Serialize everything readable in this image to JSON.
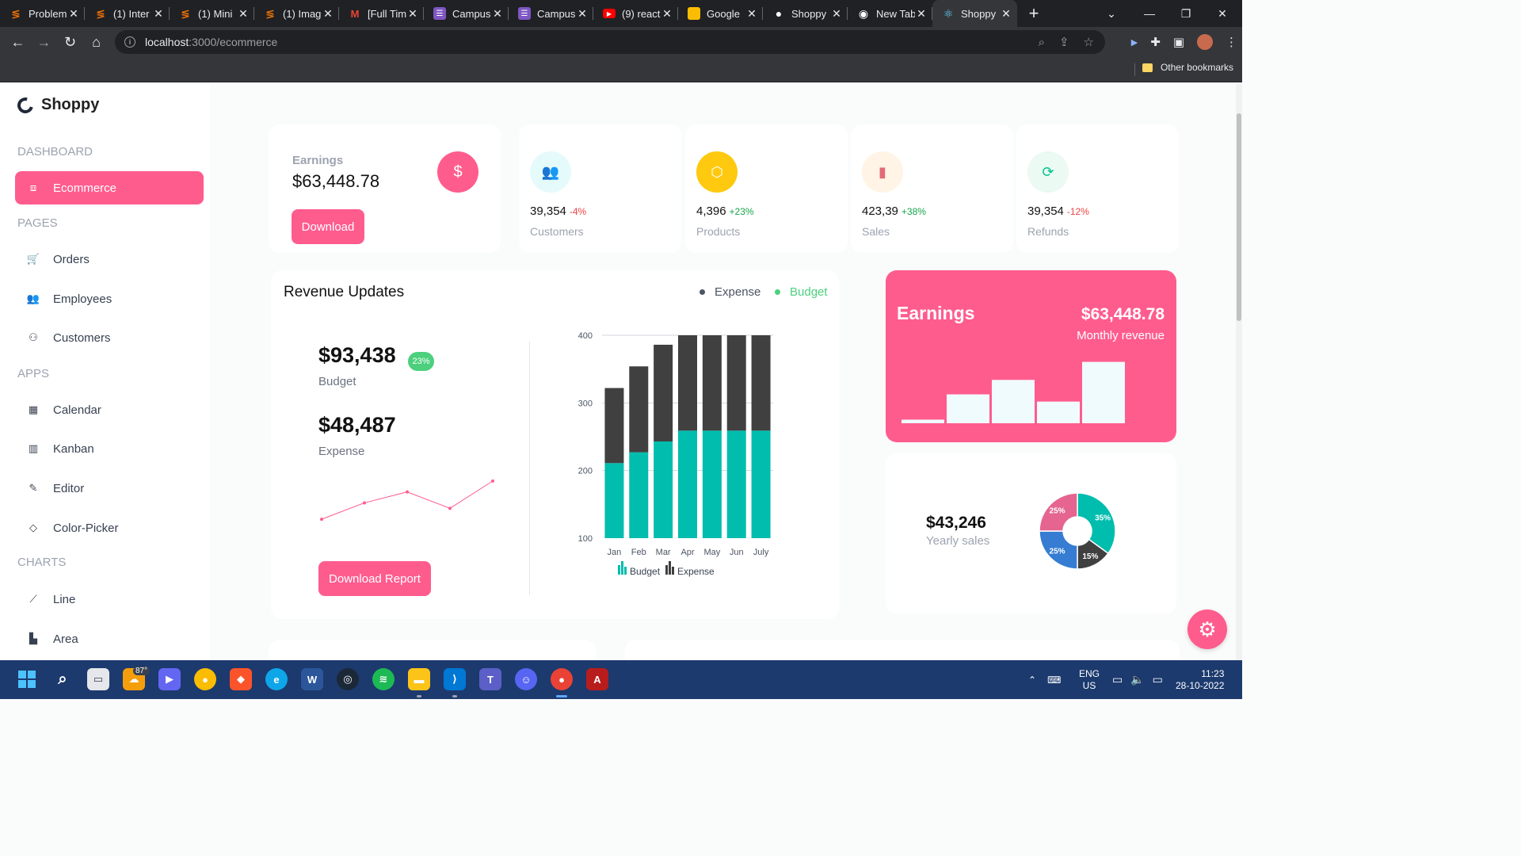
{
  "browser": {
    "tabs": [
      {
        "title": "Problem",
        "favicon": "codeforces",
        "color": "#e8710a"
      },
      {
        "title": "(1) Inter",
        "favicon": "codeforces",
        "color": "#e8710a"
      },
      {
        "title": "(1) Mini",
        "favicon": "codeforces",
        "color": "#e8710a"
      },
      {
        "title": "(1) Imag",
        "favicon": "codeforces",
        "color": "#e8710a"
      },
      {
        "title": "[Full Tim",
        "favicon": "gmail",
        "color": "#ea4335"
      },
      {
        "title": "Campus",
        "favicon": "list",
        "color": "#7e57c2"
      },
      {
        "title": "Campus",
        "favicon": "list",
        "color": "#7e57c2"
      },
      {
        "title": "(9) react",
        "favicon": "youtube",
        "color": "#ff0000"
      },
      {
        "title": "Google",
        "favicon": "keep",
        "color": "#fbbc04"
      },
      {
        "title": "Shoppy",
        "favicon": "github",
        "color": "#ffffff"
      },
      {
        "title": "New Tab",
        "favicon": "chrome",
        "color": "#ffffff"
      },
      {
        "title": "Shoppy",
        "favicon": "react",
        "color": "#61dafb",
        "active": true
      }
    ],
    "url_host": "localhost",
    "url_path": ":3000/ecommerce",
    "bookmarks_other": "Other bookmarks"
  },
  "sidebar": {
    "brand": "Shoppy",
    "sections": [
      {
        "title": "DASHBOARD",
        "items": [
          {
            "label": "Ecommerce",
            "icon": "shopping-bag-icon",
            "active": true
          }
        ]
      },
      {
        "title": "PAGES",
        "items": [
          {
            "label": "Orders",
            "icon": "cart-icon"
          },
          {
            "label": "Employees",
            "icon": "people-icon"
          },
          {
            "label": "Customers",
            "icon": "customer-icon"
          }
        ]
      },
      {
        "title": "APPS",
        "items": [
          {
            "label": "Calendar",
            "icon": "calendar-icon"
          },
          {
            "label": "Kanban",
            "icon": "kanban-icon"
          },
          {
            "label": "Editor",
            "icon": "edit-icon"
          },
          {
            "label": "Color-Picker",
            "icon": "color-picker-icon"
          }
        ]
      },
      {
        "title": "CHARTS",
        "items": [
          {
            "label": "Line",
            "icon": "line-chart-icon"
          },
          {
            "label": "Area",
            "icon": "area-chart-icon"
          }
        ]
      }
    ]
  },
  "earnings_card": {
    "label": "Earnings",
    "value": "$63,448.78",
    "button": "Download",
    "icon": "dollar-icon"
  },
  "stats": [
    {
      "value": "39,354",
      "percentage": "-4%",
      "title": "Customers",
      "icon": "customers-icon",
      "icon_color": "#03c9d7",
      "icon_bg": "#e5fafb",
      "pct_color": "#ef4444"
    },
    {
      "value": "4,396",
      "percentage": "+23%",
      "title": "Products",
      "icon": "box-icon",
      "icon_color": "#ffffff",
      "icon_bg": "#fec90f",
      "pct_color": "#16a34a"
    },
    {
      "value": "423,39",
      "percentage": "+38%",
      "title": "Sales",
      "icon": "bar-chart-icon",
      "icon_color": "#e46a76",
      "icon_bg": "#fff4e5",
      "pct_color": "#16a34a"
    },
    {
      "value": "39,354",
      "percentage": "-12%",
      "title": "Refunds",
      "icon": "refresh-icon",
      "icon_color": "#00c292",
      "icon_bg": "#ebfaf2",
      "pct_color": "#ef4444"
    }
  ],
  "revenue": {
    "title": "Revenue Updates",
    "legend": [
      {
        "label": "Expense",
        "color": "#4b5563"
      },
      {
        "label": "Budget",
        "color": "#4cd07d"
      }
    ],
    "budget_value": "$93,438",
    "budget_pct": "23%",
    "budget_label": "Budget",
    "expense_value": "$48,487",
    "expense_label": "Expense",
    "button": "Download Report"
  },
  "pink_card": {
    "title": "Earnings",
    "value": "$63,448.78",
    "subtitle": "Monthly revenue"
  },
  "yearly": {
    "value": "$43,246",
    "label": "Yearly sales"
  },
  "chart_data": [
    {
      "type": "bar",
      "stacked": true,
      "categories": [
        "Jan",
        "Feb",
        "Mar",
        "Apr",
        "May",
        "Jun",
        "July"
      ],
      "series": [
        {
          "name": "Budget",
          "values": [
            111,
            127,
            143,
            159,
            159,
            159,
            159
          ],
          "color": "#00bdae"
        },
        {
          "name": "Expense",
          "values": [
            111,
            127,
            143,
            159,
            159,
            159,
            159
          ],
          "color": "#404041"
        }
      ],
      "ylim": [
        100,
        400
      ],
      "yticks": [
        100,
        200,
        300,
        400
      ],
      "grid": true,
      "legend": "bottom"
    },
    {
      "type": "line",
      "values": [
        10,
        40,
        60,
        30,
        80
      ],
      "color": "#ff5c8e"
    },
    {
      "type": "bar",
      "values": [
        1,
        8,
        12,
        6,
        17
      ],
      "color": "#f0fbfd"
    },
    {
      "type": "pie",
      "donut": true,
      "labels": [
        "35%",
        "15%",
        "25%",
        "25%"
      ],
      "values": [
        35,
        15,
        25,
        25
      ],
      "colors": [
        "#00bdae",
        "#404041",
        "#357cd2",
        "#e56590"
      ]
    }
  ],
  "taskbar": {
    "weather": "87°",
    "lang_top": "ENG",
    "lang_bottom": "US",
    "time": "11:23",
    "date": "28-10-2022"
  }
}
